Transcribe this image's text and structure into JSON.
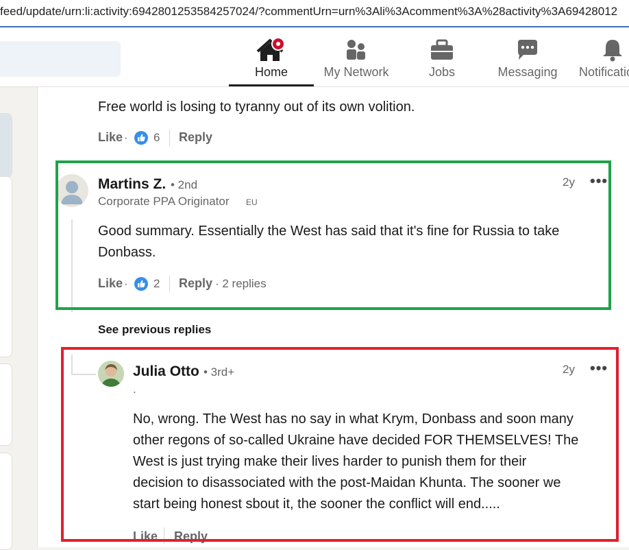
{
  "browser": {
    "url": "feed/update/urn:li:activity:6942801253584257024/?commentUrn=urn%3Ali%3Acomment%3A%28activity%3A69428012"
  },
  "nav": {
    "items": [
      {
        "label": "Home",
        "icon": "home-icon",
        "active": true,
        "badge": true
      },
      {
        "label": "My Network",
        "icon": "people-icon"
      },
      {
        "label": "Jobs",
        "icon": "briefcase-icon"
      },
      {
        "label": "Messaging",
        "icon": "chat-icon"
      },
      {
        "label": "Notifications",
        "icon": "bell-icon"
      }
    ]
  },
  "feed": {
    "previous_comment": {
      "text": "Free world is losing to tyranny out of its own volition.",
      "like_label": "Like",
      "reaction_count": "6",
      "reply_label": "Reply"
    },
    "comment1": {
      "name": "Martins Z.",
      "degree": "• 2nd",
      "headline": "Corporate PPA Originator",
      "headline_tag": "EU",
      "time": "2y",
      "text_line1": "Good summary. Essentially the West has said that it's fine for Russia to take",
      "text_line2": "Donbass.",
      "like_label": "Like",
      "reaction_count": "2",
      "reply_label": "Reply",
      "replies_label": "· 2 replies"
    },
    "see_previous": "See previous replies",
    "reply1": {
      "name": "Julia Otto",
      "degree": "• 3rd+",
      "headline": ".",
      "time": "2y",
      "text_lines": [
        "No, wrong. The West has no say in what Krym, Donbass and soon many",
        "other regons of so-called Ukraine have decided FOR THEMSELVES! The",
        "West is just trying make their lives harder to punish them for their",
        "decision to disassociated with the post-Maidan Khunta. The sooner we",
        "start being honest sbout it, the sooner the conflict will end....."
      ],
      "like_label": "Like",
      "reply_label": "Reply"
    },
    "dot_separator": "·",
    "more_label": "•••"
  },
  "colors": {
    "highlight_green": "#1fa24a",
    "highlight_red": "#e0202e",
    "like_blue": "#378fe9",
    "badge_red": "#cb112d"
  }
}
